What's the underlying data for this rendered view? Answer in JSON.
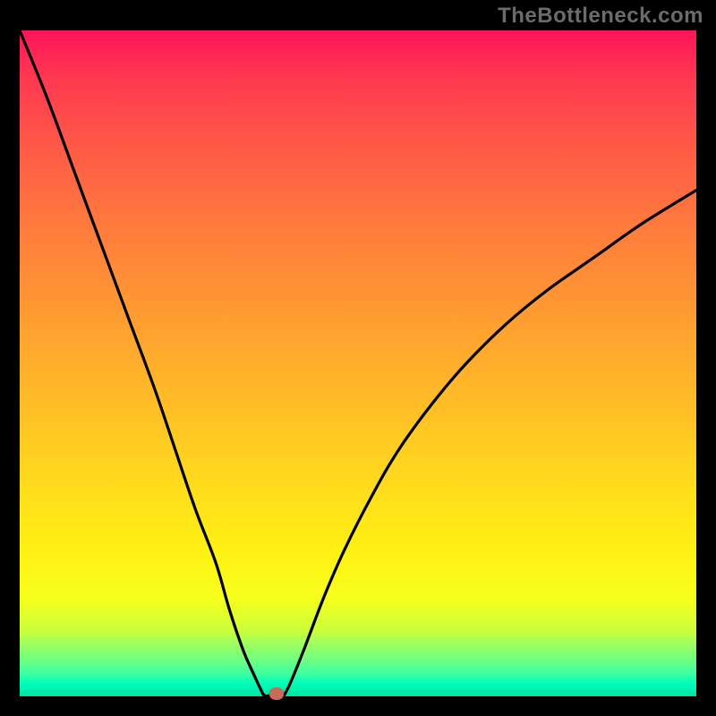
{
  "watermark": "TheBottleneck.com",
  "colors": {
    "background": "#000000",
    "gradient_top": "#ff1459",
    "gradient_bottom": "#00e3a2",
    "curve": "#000000",
    "marker": "#c96a5a"
  },
  "chart_data": {
    "type": "line",
    "title": "",
    "xlabel": "",
    "ylabel": "",
    "xlim": [
      0,
      100
    ],
    "ylim": [
      0,
      100
    ],
    "series": [
      {
        "name": "curve-left",
        "x": [
          0,
          4,
          8,
          12,
          16,
          20,
          23,
          26,
          29,
          31,
          33,
          34.5,
          35.5,
          36,
          36.4
        ],
        "values": [
          100,
          90,
          79,
          68,
          57,
          46,
          37,
          28,
          20,
          13,
          7,
          3.5,
          1.3,
          0.3,
          0
        ]
      },
      {
        "name": "curve-right",
        "x": [
          39,
          40,
          42,
          45,
          48,
          52,
          56,
          61,
          66,
          72,
          78,
          85,
          92,
          100
        ],
        "values": [
          0,
          2,
          7,
          15,
          22,
          30,
          37,
          44,
          50,
          56,
          61,
          66,
          71,
          76
        ]
      }
    ],
    "marker": {
      "x": 38,
      "y": 0
    }
  }
}
